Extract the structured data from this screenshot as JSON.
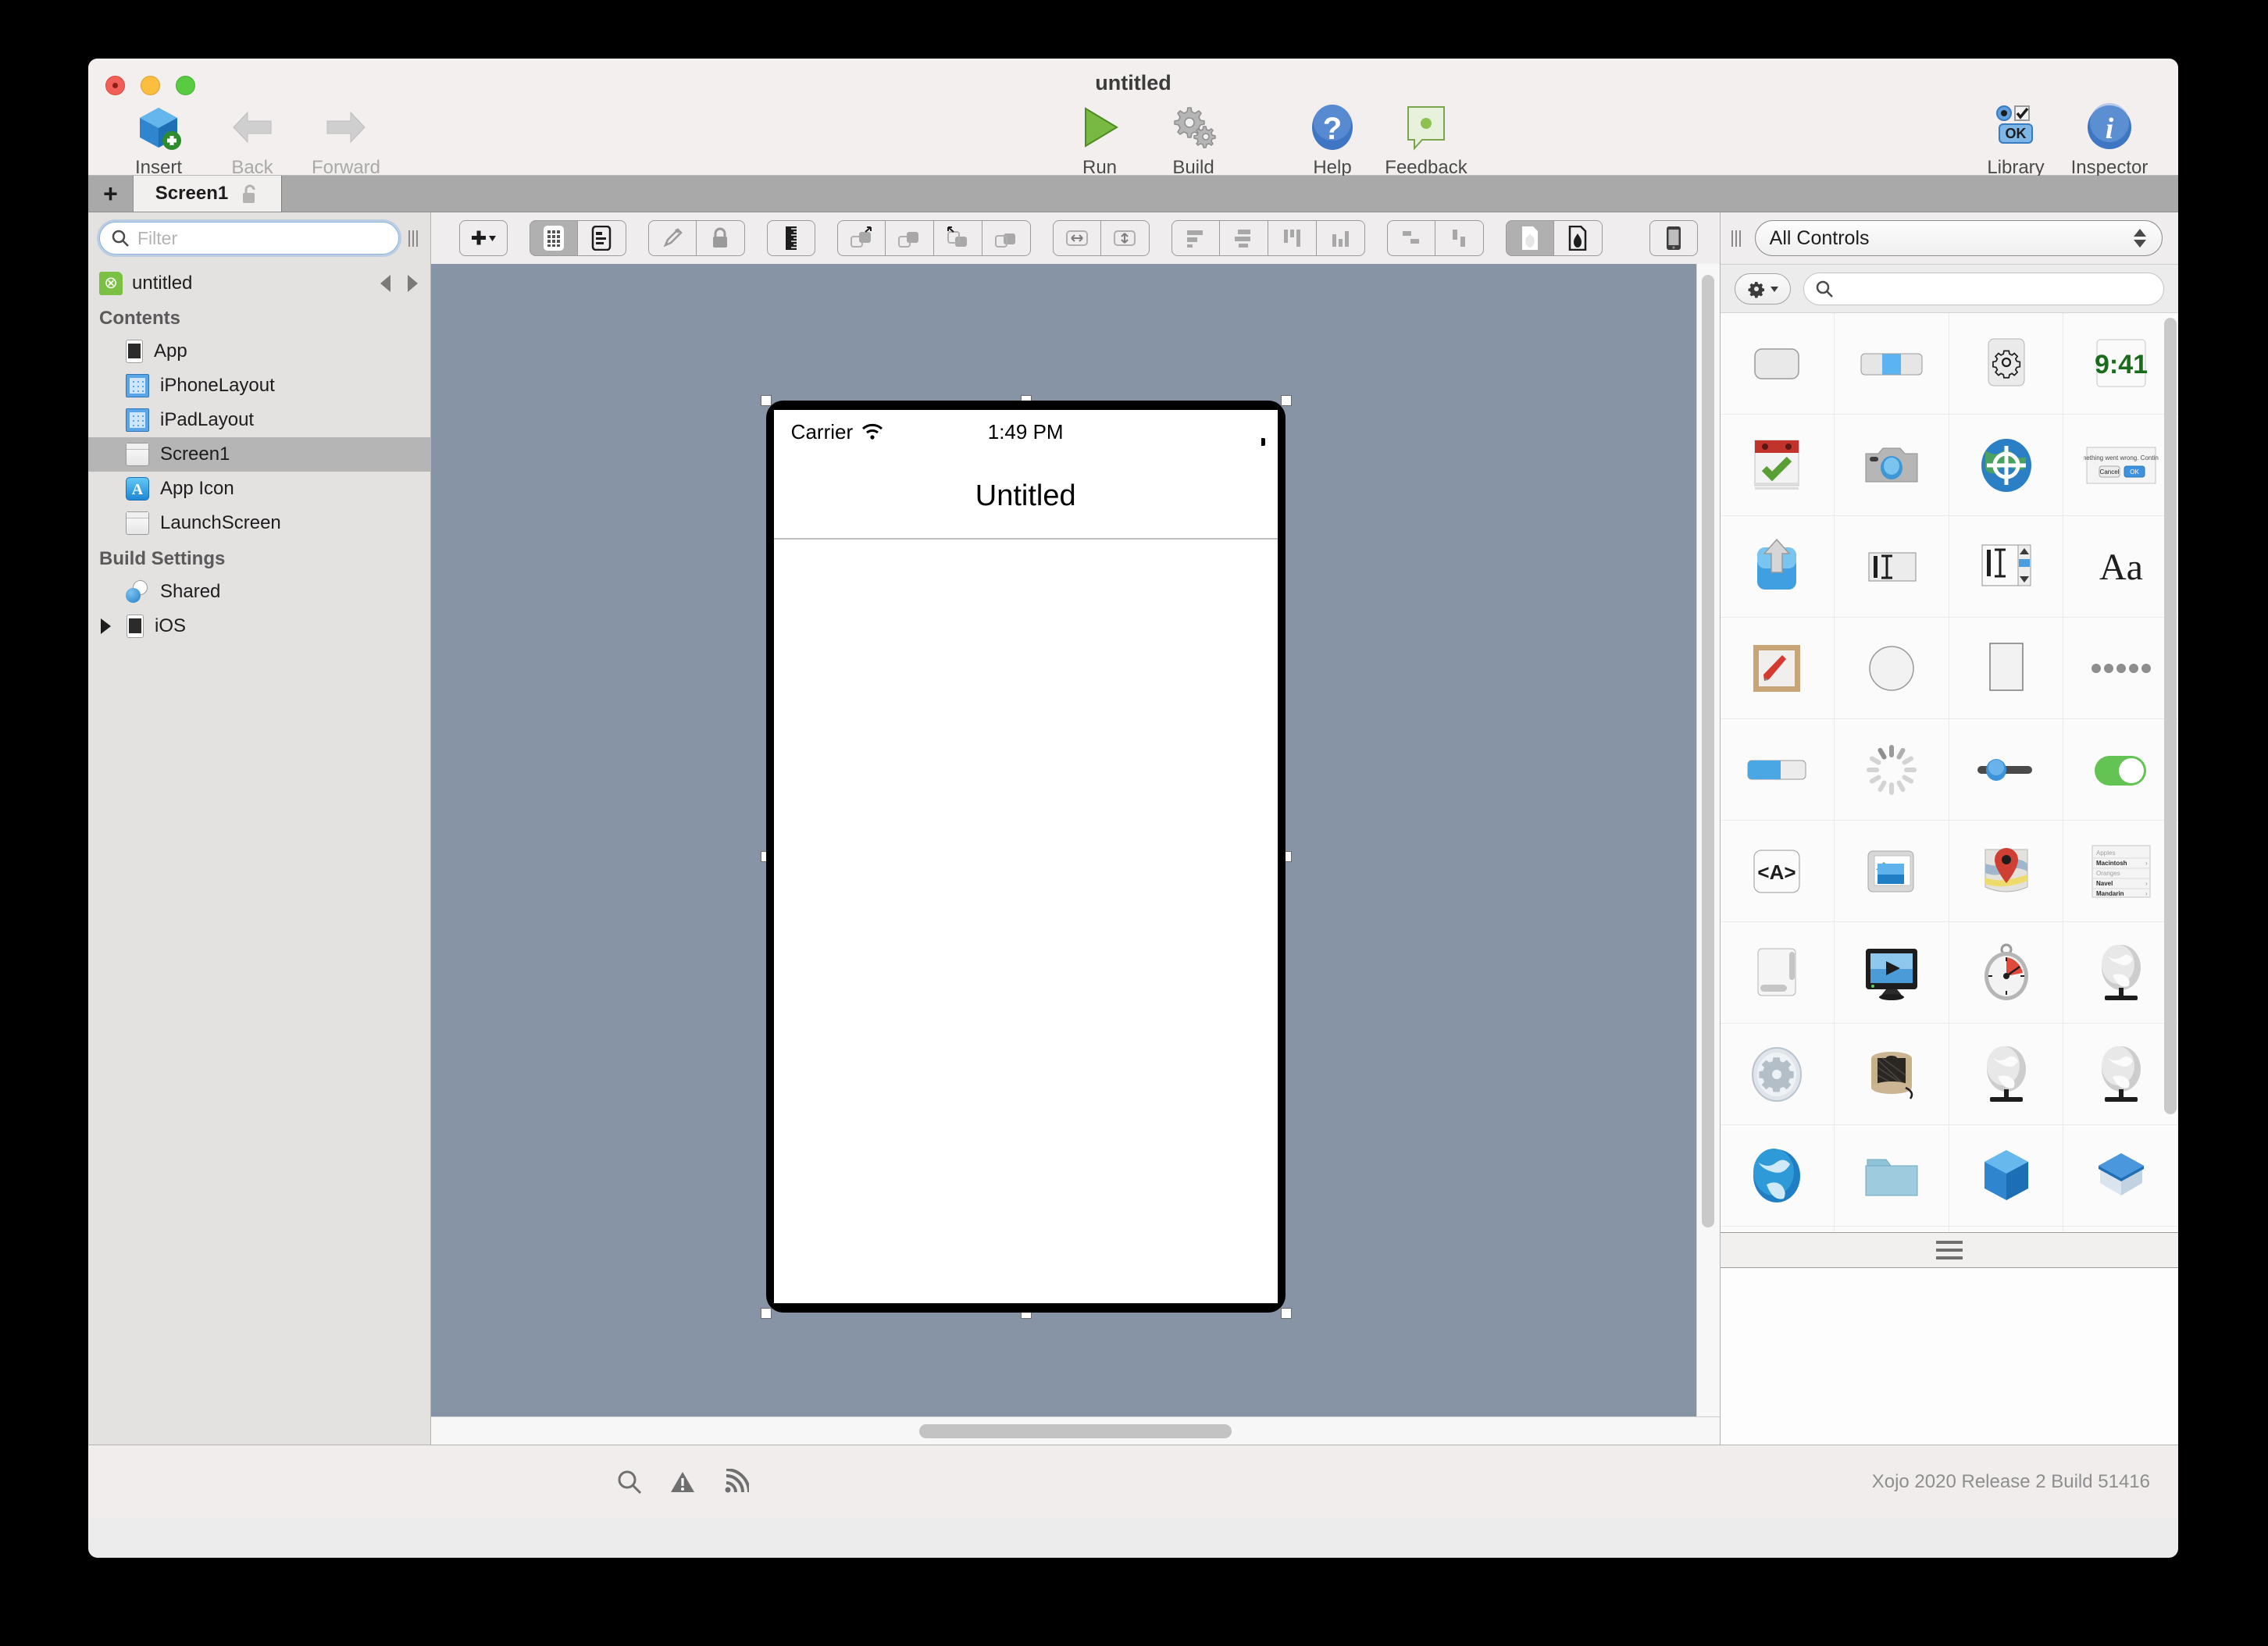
{
  "window": {
    "title": "untitled"
  },
  "toolbar": {
    "left": [
      {
        "label": "Insert",
        "icon": "insert-cube-icon",
        "enabled": true
      },
      {
        "label": "Back",
        "icon": "back-arrow-icon",
        "enabled": false
      },
      {
        "label": "Forward",
        "icon": "forward-arrow-icon",
        "enabled": false
      }
    ],
    "middle": [
      {
        "label": "Run",
        "icon": "run-play-icon"
      },
      {
        "label": "Build",
        "icon": "build-gears-icon"
      },
      {
        "label": "Help",
        "icon": "help-question-icon"
      },
      {
        "label": "Feedback",
        "icon": "feedback-speech-icon"
      }
    ],
    "right": [
      {
        "label": "Library",
        "icon": "library-ok-icon"
      },
      {
        "label": "Inspector",
        "icon": "inspector-info-icon"
      }
    ]
  },
  "tabs": {
    "add_label": "+",
    "items": [
      {
        "label": "Screen1",
        "icon": "unlock-icon",
        "active": true
      }
    ]
  },
  "navigator": {
    "filter_placeholder": "Filter",
    "filter_value": "",
    "project_name": "untitled",
    "sections": [
      {
        "title": "Contents",
        "items": [
          {
            "label": "App",
            "icon": "phone-icon",
            "selected": false,
            "disclosure": false
          },
          {
            "label": "iPhoneLayout",
            "icon": "grid-icon",
            "selected": false,
            "disclosure": false
          },
          {
            "label": "iPadLayout",
            "icon": "grid-icon",
            "selected": false,
            "disclosure": false
          },
          {
            "label": "Screen1",
            "icon": "window-icon",
            "selected": true,
            "disclosure": false
          },
          {
            "label": "App Icon",
            "icon": "app-icon",
            "selected": false,
            "disclosure": false
          },
          {
            "label": "LaunchScreen",
            "icon": "window-icon",
            "selected": false,
            "disclosure": false
          }
        ]
      },
      {
        "title": "Build Settings",
        "items": [
          {
            "label": "Shared",
            "icon": "shared-icon",
            "selected": false,
            "disclosure": false
          },
          {
            "label": "iOS",
            "icon": "phone-icon",
            "selected": false,
            "disclosure": true
          }
        ]
      }
    ]
  },
  "editor_toolbar": {
    "groups": [
      {
        "name": "insert-control",
        "buttons": [
          {
            "icon": "plus-dropdown-icon",
            "active": false
          }
        ]
      },
      {
        "name": "view-mode",
        "buttons": [
          {
            "icon": "layout-grid-icon",
            "active": true
          },
          {
            "icon": "layout-list-icon",
            "active": false
          }
        ]
      },
      {
        "name": "edit-lock",
        "buttons": [
          {
            "icon": "pencil-icon",
            "active": false
          },
          {
            "icon": "lock-icon",
            "active": false
          }
        ]
      },
      {
        "name": "ruler",
        "buttons": [
          {
            "icon": "ruler-icon",
            "active": false
          }
        ]
      },
      {
        "name": "arrange",
        "buttons": [
          {
            "icon": "bring-to-front-icon",
            "active": false
          },
          {
            "icon": "bring-forward-icon",
            "active": false
          },
          {
            "icon": "send-backward-icon",
            "active": false
          },
          {
            "icon": "send-to-back-icon",
            "active": false
          }
        ]
      },
      {
        "name": "size",
        "buttons": [
          {
            "icon": "resize-width-icon",
            "active": false
          },
          {
            "icon": "resize-height-icon",
            "active": false
          }
        ]
      },
      {
        "name": "align",
        "buttons": [
          {
            "icon": "align-left-icon",
            "active": false
          },
          {
            "icon": "align-center-icon",
            "active": false
          },
          {
            "icon": "align-top-icon",
            "active": false
          },
          {
            "icon": "align-bottom-icon",
            "active": false
          }
        ]
      },
      {
        "name": "distribute",
        "buttons": [
          {
            "icon": "distribute-horizontal-icon",
            "active": false
          },
          {
            "icon": "distribute-vertical-icon",
            "active": false
          }
        ]
      },
      {
        "name": "contrast",
        "buttons": [
          {
            "icon": "light-appearance-icon",
            "active": true
          },
          {
            "icon": "dark-appearance-icon",
            "active": false
          }
        ]
      },
      {
        "name": "device",
        "buttons": [
          {
            "icon": "device-preview-icon",
            "active": false
          }
        ]
      }
    ]
  },
  "device_preview": {
    "carrier": "Carrier",
    "time": "1:49 PM",
    "screen_title": "Untitled",
    "wifi_icon": "wifi-icon",
    "battery_icon": "battery-icon"
  },
  "library": {
    "filter_label": "All Controls",
    "search_placeholder": "",
    "search_value": "",
    "gear_icon": "gear-dropdown-icon",
    "items": [
      {
        "name": "button-control",
        "icon": "rounded-button-icon"
      },
      {
        "name": "segmented-control",
        "icon": "segmented-icon"
      },
      {
        "name": "settings-control",
        "icon": "gear-panel-icon"
      },
      {
        "name": "time-label-control",
        "icon": "clock-941-icon"
      },
      {
        "name": "date-picker-control",
        "icon": "calendar-check-icon"
      },
      {
        "name": "camera-control",
        "icon": "camera-icon"
      },
      {
        "name": "location-control",
        "icon": "globe-target-icon"
      },
      {
        "name": "message-dialog-control",
        "icon": "alert-dialog-icon"
      },
      {
        "name": "share-control",
        "icon": "share-arrow-icon"
      },
      {
        "name": "text-field-control",
        "icon": "text-field-icon"
      },
      {
        "name": "text-area-control",
        "icon": "text-area-icon"
      },
      {
        "name": "label-control",
        "icon": "aa-type-icon"
      },
      {
        "name": "canvas-control",
        "icon": "canvas-paint-icon"
      },
      {
        "name": "oval-control",
        "icon": "oval-icon"
      },
      {
        "name": "rectangle-control",
        "icon": "rectangle-icon"
      },
      {
        "name": "page-control",
        "icon": "page-dots-icon"
      },
      {
        "name": "progress-bar-control",
        "icon": "progress-bar-icon"
      },
      {
        "name": "progress-wheel-control",
        "icon": "spinner-icon"
      },
      {
        "name": "slider-control",
        "icon": "slider-icon"
      },
      {
        "name": "switch-control",
        "icon": "toggle-switch-icon"
      },
      {
        "name": "html-viewer-control",
        "icon": "code-tag-icon"
      },
      {
        "name": "image-viewer-control",
        "icon": "image-stack-icon"
      },
      {
        "name": "map-viewer-control",
        "icon": "map-pin-icon"
      },
      {
        "name": "table-control",
        "icon": "table-list-icon"
      },
      {
        "name": "scroll-view-control",
        "icon": "scroll-panel-icon"
      },
      {
        "name": "movie-player-control",
        "icon": "monitor-play-icon"
      },
      {
        "name": "timer-control",
        "icon": "stopwatch-icon"
      },
      {
        "name": "http-socket-control",
        "icon": "globe-stand-icon"
      },
      {
        "name": "xojo-script-control",
        "icon": "gear-oval-icon"
      },
      {
        "name": "serial-control",
        "icon": "spool-icon"
      },
      {
        "name": "url-connection-control",
        "icon": "globe-stand-icon"
      },
      {
        "name": "socket-control",
        "icon": "globe-stand-icon"
      },
      {
        "name": "web-globe-control",
        "icon": "globe-blue-icon"
      },
      {
        "name": "folder-item-control",
        "icon": "folder-icon"
      },
      {
        "name": "module-control",
        "icon": "cube-blue-icon"
      },
      {
        "name": "class-control",
        "icon": "cube-open-icon"
      },
      {
        "name": "menu-control",
        "icon": "table-list-icon"
      },
      {
        "name": "file-control",
        "icon": "page-curl-icon"
      },
      {
        "name": "container-control",
        "icon": "cube-grey-icon"
      },
      {
        "name": "window-control",
        "icon": "window-title-icon"
      }
    ]
  },
  "status_bar": {
    "icons": [
      {
        "name": "search-icon"
      },
      {
        "name": "warning-icon"
      },
      {
        "name": "broadcast-icon"
      }
    ],
    "version": "Xojo 2020 Release 2 Build 51416"
  }
}
